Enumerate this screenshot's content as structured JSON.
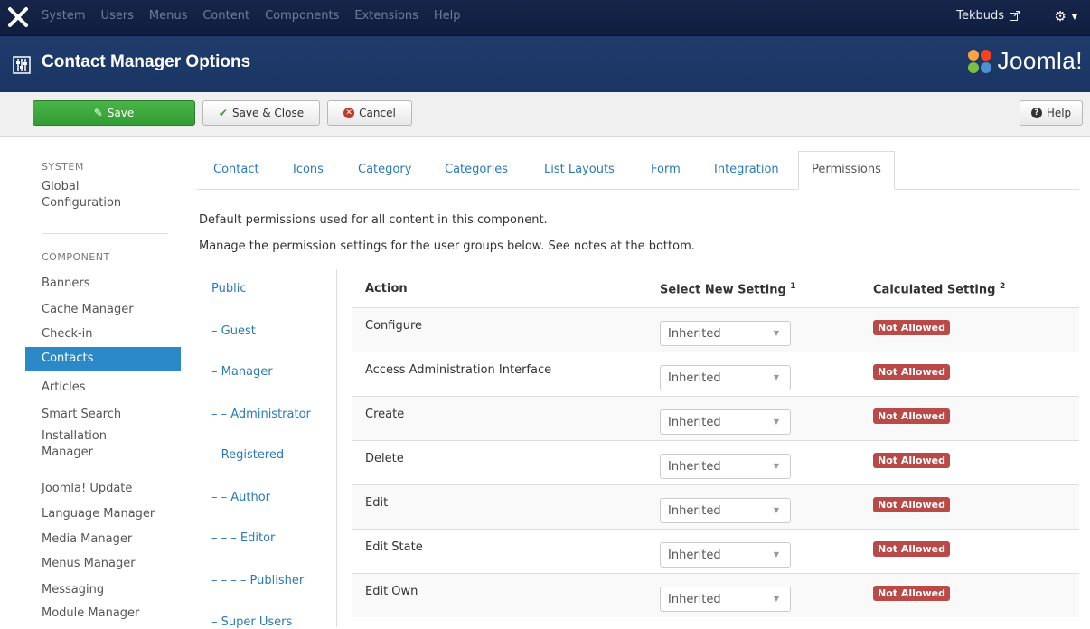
{
  "topbar": {
    "menu": [
      "System",
      "Users",
      "Menus",
      "Content",
      "Components",
      "Extensions",
      "Help"
    ],
    "user": "Tekbuds"
  },
  "title": "Contact Manager Options",
  "brand": "Joomla!",
  "toolbar": {
    "save": "Save",
    "save_close": "Save & Close",
    "cancel": "Cancel",
    "help": "Help"
  },
  "sidebar": {
    "system_heading": "SYSTEM",
    "global_configuration": "Global Configuration",
    "component_heading": "COMPONENT",
    "items": [
      "Banners",
      "Cache Manager",
      "Check-in",
      "Contacts",
      "Articles",
      "Smart Search",
      "Installation Manager",
      "Joomla! Update",
      "Language Manager",
      "Media Manager",
      "Menus Manager",
      "Messaging",
      "Module Manager"
    ],
    "active": "Contacts"
  },
  "tabs": [
    "Contact",
    "Icons",
    "Category",
    "Categories",
    "List Layouts",
    "Form",
    "Integration",
    "Permissions"
  ],
  "active_tab": "Permissions",
  "notes": {
    "line1": "Default permissions used for all content in this component.",
    "line2": "Manage the permission settings for the user groups below. See notes at the bottom."
  },
  "groups": [
    "Public",
    "– Guest",
    "– Manager",
    "– – Administrator",
    "– Registered",
    "– – Author",
    "– – – Editor",
    "– – – – Publisher",
    "– Super Users"
  ],
  "table": {
    "headers": {
      "action": "Action",
      "select": "Select New Setting",
      "select_sup": "1",
      "calculated": "Calculated Setting",
      "calculated_sup": "2"
    },
    "rows": [
      {
        "action": "Configure",
        "setting": "Inherited",
        "calculated": "Not Allowed"
      },
      {
        "action": "Access Administration Interface",
        "setting": "Inherited",
        "calculated": "Not Allowed"
      },
      {
        "action": "Create",
        "setting": "Inherited",
        "calculated": "Not Allowed"
      },
      {
        "action": "Delete",
        "setting": "Inherited",
        "calculated": "Not Allowed"
      },
      {
        "action": "Edit",
        "setting": "Inherited",
        "calculated": "Not Allowed"
      },
      {
        "action": "Edit State",
        "setting": "Inherited",
        "calculated": "Not Allowed"
      },
      {
        "action": "Edit Own",
        "setting": "Inherited",
        "calculated": "Not Allowed"
      }
    ]
  },
  "colors": {
    "topbar": "#17254a",
    "titlebar": "#1f3c6d",
    "save": "#3ea83e",
    "active": "#2b89c8",
    "badge": "#b94a48"
  }
}
